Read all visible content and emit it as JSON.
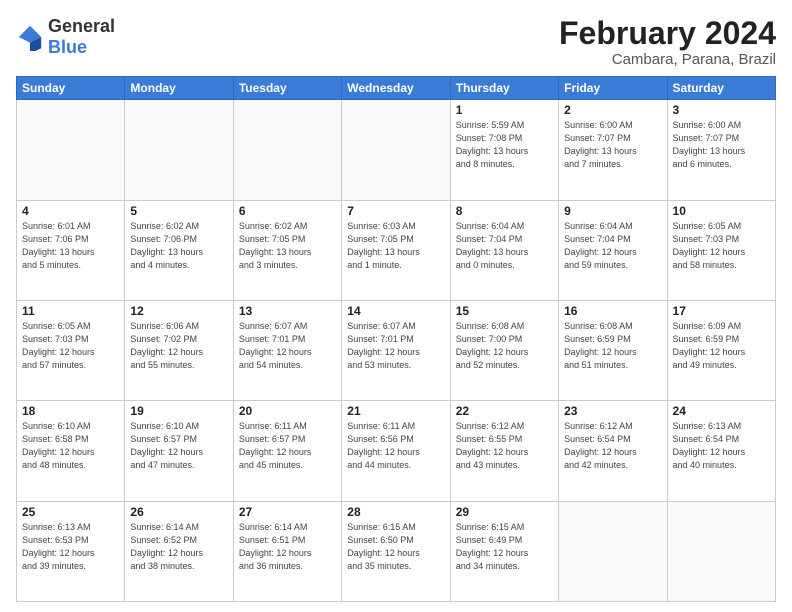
{
  "header": {
    "logo_general": "General",
    "logo_blue": "Blue",
    "month_title": "February 2024",
    "location": "Cambara, Parana, Brazil"
  },
  "days_of_week": [
    "Sunday",
    "Monday",
    "Tuesday",
    "Wednesday",
    "Thursday",
    "Friday",
    "Saturday"
  ],
  "weeks": [
    [
      {
        "day": "",
        "info": ""
      },
      {
        "day": "",
        "info": ""
      },
      {
        "day": "",
        "info": ""
      },
      {
        "day": "",
        "info": ""
      },
      {
        "day": "1",
        "info": "Sunrise: 5:59 AM\nSunset: 7:08 PM\nDaylight: 13 hours\nand 8 minutes."
      },
      {
        "day": "2",
        "info": "Sunrise: 6:00 AM\nSunset: 7:07 PM\nDaylight: 13 hours\nand 7 minutes."
      },
      {
        "day": "3",
        "info": "Sunrise: 6:00 AM\nSunset: 7:07 PM\nDaylight: 13 hours\nand 6 minutes."
      }
    ],
    [
      {
        "day": "4",
        "info": "Sunrise: 6:01 AM\nSunset: 7:06 PM\nDaylight: 13 hours\nand 5 minutes."
      },
      {
        "day": "5",
        "info": "Sunrise: 6:02 AM\nSunset: 7:06 PM\nDaylight: 13 hours\nand 4 minutes."
      },
      {
        "day": "6",
        "info": "Sunrise: 6:02 AM\nSunset: 7:05 PM\nDaylight: 13 hours\nand 3 minutes."
      },
      {
        "day": "7",
        "info": "Sunrise: 6:03 AM\nSunset: 7:05 PM\nDaylight: 13 hours\nand 1 minute."
      },
      {
        "day": "8",
        "info": "Sunrise: 6:04 AM\nSunset: 7:04 PM\nDaylight: 13 hours\nand 0 minutes."
      },
      {
        "day": "9",
        "info": "Sunrise: 6:04 AM\nSunset: 7:04 PM\nDaylight: 12 hours\nand 59 minutes."
      },
      {
        "day": "10",
        "info": "Sunrise: 6:05 AM\nSunset: 7:03 PM\nDaylight: 12 hours\nand 58 minutes."
      }
    ],
    [
      {
        "day": "11",
        "info": "Sunrise: 6:05 AM\nSunset: 7:03 PM\nDaylight: 12 hours\nand 57 minutes."
      },
      {
        "day": "12",
        "info": "Sunrise: 6:06 AM\nSunset: 7:02 PM\nDaylight: 12 hours\nand 55 minutes."
      },
      {
        "day": "13",
        "info": "Sunrise: 6:07 AM\nSunset: 7:01 PM\nDaylight: 12 hours\nand 54 minutes."
      },
      {
        "day": "14",
        "info": "Sunrise: 6:07 AM\nSunset: 7:01 PM\nDaylight: 12 hours\nand 53 minutes."
      },
      {
        "day": "15",
        "info": "Sunrise: 6:08 AM\nSunset: 7:00 PM\nDaylight: 12 hours\nand 52 minutes."
      },
      {
        "day": "16",
        "info": "Sunrise: 6:08 AM\nSunset: 6:59 PM\nDaylight: 12 hours\nand 51 minutes."
      },
      {
        "day": "17",
        "info": "Sunrise: 6:09 AM\nSunset: 6:59 PM\nDaylight: 12 hours\nand 49 minutes."
      }
    ],
    [
      {
        "day": "18",
        "info": "Sunrise: 6:10 AM\nSunset: 6:58 PM\nDaylight: 12 hours\nand 48 minutes."
      },
      {
        "day": "19",
        "info": "Sunrise: 6:10 AM\nSunset: 6:57 PM\nDaylight: 12 hours\nand 47 minutes."
      },
      {
        "day": "20",
        "info": "Sunrise: 6:11 AM\nSunset: 6:57 PM\nDaylight: 12 hours\nand 45 minutes."
      },
      {
        "day": "21",
        "info": "Sunrise: 6:11 AM\nSunset: 6:56 PM\nDaylight: 12 hours\nand 44 minutes."
      },
      {
        "day": "22",
        "info": "Sunrise: 6:12 AM\nSunset: 6:55 PM\nDaylight: 12 hours\nand 43 minutes."
      },
      {
        "day": "23",
        "info": "Sunrise: 6:12 AM\nSunset: 6:54 PM\nDaylight: 12 hours\nand 42 minutes."
      },
      {
        "day": "24",
        "info": "Sunrise: 6:13 AM\nSunset: 6:54 PM\nDaylight: 12 hours\nand 40 minutes."
      }
    ],
    [
      {
        "day": "25",
        "info": "Sunrise: 6:13 AM\nSunset: 6:53 PM\nDaylight: 12 hours\nand 39 minutes."
      },
      {
        "day": "26",
        "info": "Sunrise: 6:14 AM\nSunset: 6:52 PM\nDaylight: 12 hours\nand 38 minutes."
      },
      {
        "day": "27",
        "info": "Sunrise: 6:14 AM\nSunset: 6:51 PM\nDaylight: 12 hours\nand 36 minutes."
      },
      {
        "day": "28",
        "info": "Sunrise: 6:15 AM\nSunset: 6:50 PM\nDaylight: 12 hours\nand 35 minutes."
      },
      {
        "day": "29",
        "info": "Sunrise: 6:15 AM\nSunset: 6:49 PM\nDaylight: 12 hours\nand 34 minutes."
      },
      {
        "day": "",
        "info": ""
      },
      {
        "day": "",
        "info": ""
      }
    ]
  ]
}
